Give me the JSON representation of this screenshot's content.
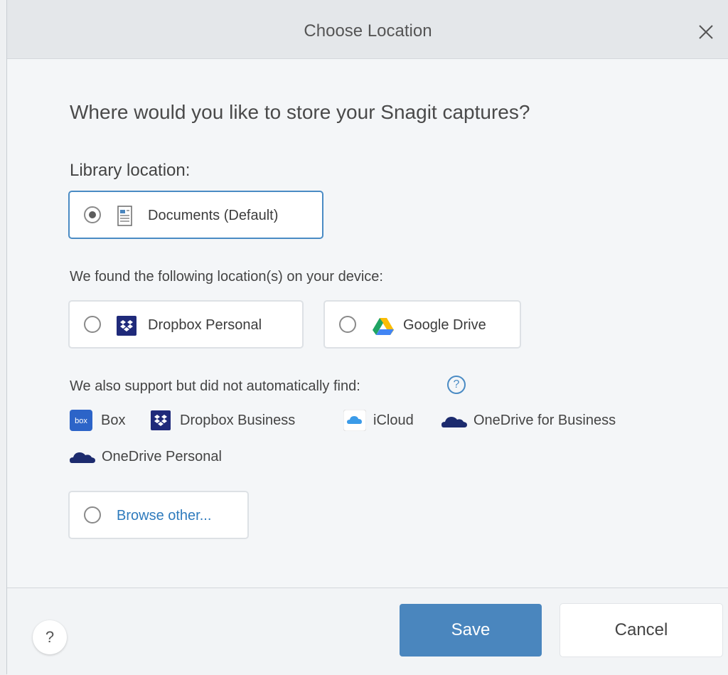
{
  "dialog": {
    "title": "Choose Location",
    "question": "Where would you like to store your Snagit captures?"
  },
  "library": {
    "label": "Library location:",
    "default_option": "Documents (Default)"
  },
  "found": {
    "label": "We found the following location(s) on your device:",
    "options": [
      "Dropbox Personal",
      "Google Drive"
    ]
  },
  "also": {
    "label": "We also support but did not automatically find:",
    "help_glyph": "?",
    "services": [
      {
        "name": "Box",
        "icon": "box-icon"
      },
      {
        "name": "Dropbox Business",
        "icon": "dropbox-icon"
      },
      {
        "name": "iCloud",
        "icon": "icloud-icon"
      },
      {
        "name": "OneDrive for Business",
        "icon": "onedrive-icon"
      },
      {
        "name": "OneDrive Personal",
        "icon": "onedrive-icon"
      }
    ],
    "box_icon_text": "box"
  },
  "browse": {
    "label": "Browse other..."
  },
  "footer": {
    "help_label": "?",
    "save_label": "Save",
    "cancel_label": "Cancel"
  },
  "colors": {
    "accent": "#4a86be",
    "selected_border": "#4a8bc4",
    "link": "#2f7bbd",
    "dropbox": "#1f2a7a",
    "onedrive": "#1c2b6e"
  }
}
